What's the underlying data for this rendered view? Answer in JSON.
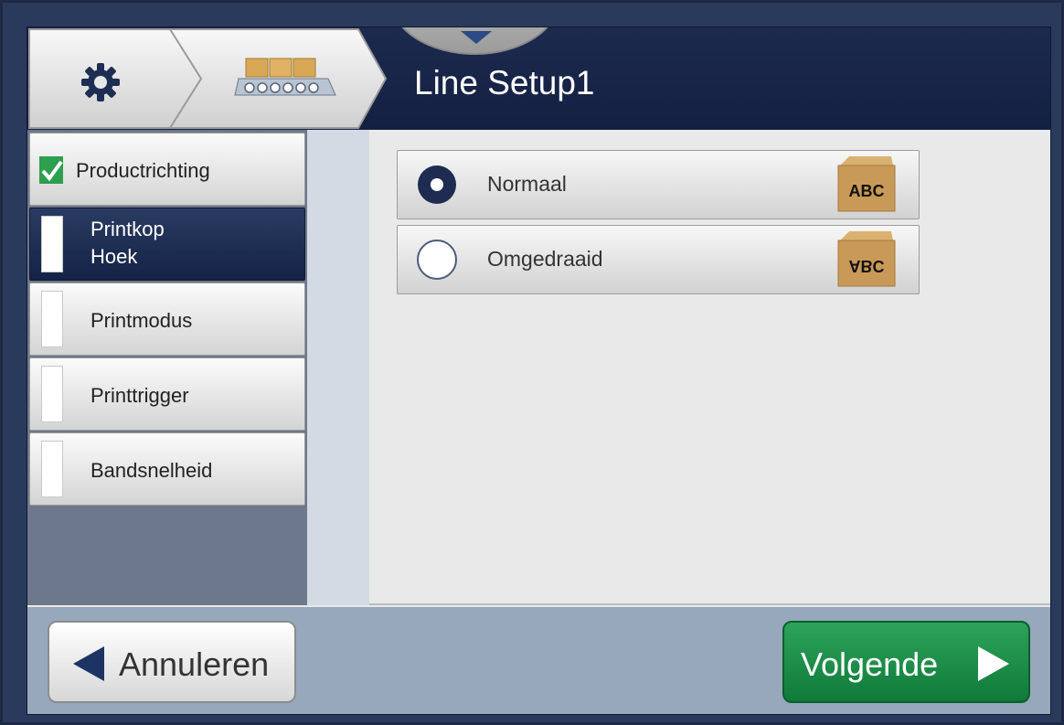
{
  "header": {
    "title": "Line Setup1",
    "breadcrumbs": [
      {
        "icon": "gear-icon"
      },
      {
        "icon": "conveyor-icon"
      }
    ]
  },
  "menu": {
    "items": [
      {
        "label": "Productrichting",
        "state": "checked"
      },
      {
        "label": "Printkop Hoek",
        "label_lines": [
          "Printkop",
          "Hoek"
        ],
        "state": "active"
      },
      {
        "label": "Printmodus",
        "state": "default"
      },
      {
        "label": "Printtrigger",
        "state": "default"
      },
      {
        "label": "Bandsnelheid",
        "state": "default"
      }
    ]
  },
  "options": [
    {
      "label": "Normaal",
      "selected": true,
      "box_text": "ABC",
      "box_orientation": "upright"
    },
    {
      "label": "Omgedraaid",
      "selected": false,
      "box_text": "ABC",
      "box_orientation": "flipped"
    }
  ],
  "footer": {
    "cancel_label": "Annuleren",
    "next_label": "Volgende"
  },
  "colors": {
    "header_bg": "#1c2a4e",
    "check_green": "#2e9e4f",
    "next_green": "#1f8f48",
    "footer_bg": "#97a7bc",
    "menu_bg": "#6e788c"
  }
}
